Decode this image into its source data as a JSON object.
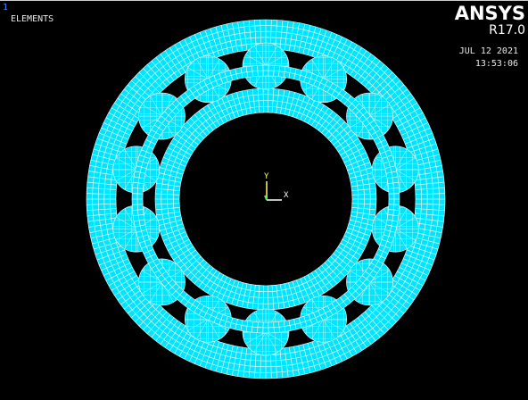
{
  "header": {
    "window_number": "1",
    "plot_type": "ELEMENTS",
    "brand": "ANSYS",
    "version": "R17.0",
    "date": "JUL 12 2021",
    "time": "13:53:06"
  },
  "triad": {
    "y_label": "Y",
    "x_label": "X",
    "y_color": "#ffff66",
    "x_color": "#ffffff",
    "z_color": "#33ff33"
  },
  "mesh": {
    "element_color": "#00e5ff",
    "line_color": "#ffffff",
    "background": "#000000",
    "rolling_element_count": 14,
    "component_names": [
      "outer-race",
      "inner-race",
      "cage",
      "rolling-element"
    ]
  }
}
